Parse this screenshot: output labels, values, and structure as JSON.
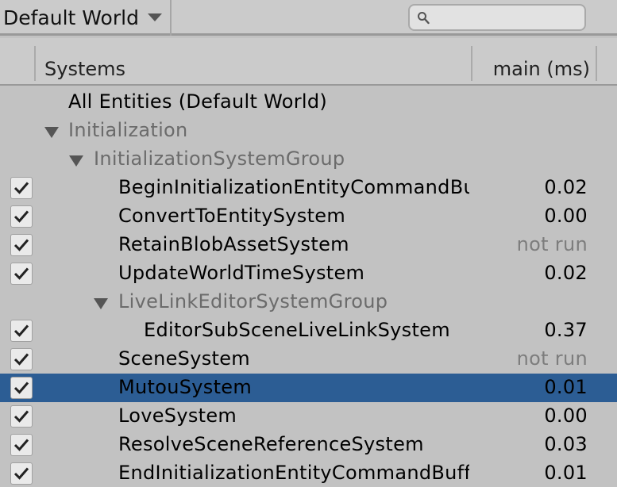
{
  "toolbar": {
    "world_label": "Default World",
    "search": {
      "value": "",
      "placeholder": ""
    }
  },
  "header": {
    "col_systems": "Systems",
    "col_main": "main (ms)"
  },
  "rows": [
    {
      "label": "All Entities (Default World)",
      "value": "",
      "checkbox": false,
      "group": false,
      "expanded": null,
      "selected": false
    },
    {
      "label": "Initialization",
      "value": "",
      "checkbox": false,
      "group": true,
      "expanded": true,
      "selected": false
    },
    {
      "label": "InitializationSystemGroup",
      "value": "",
      "checkbox": false,
      "group": true,
      "expanded": true,
      "selected": false
    },
    {
      "label": "BeginInitializationEntityCommandBufferSystem",
      "value": "0.02",
      "checkbox": true,
      "checked": true,
      "group": false,
      "selected": false
    },
    {
      "label": "ConvertToEntitySystem",
      "value": "0.00",
      "checkbox": true,
      "checked": true,
      "group": false,
      "selected": false
    },
    {
      "label": "RetainBlobAssetSystem",
      "value": "not run",
      "checkbox": true,
      "checked": true,
      "group": false,
      "selected": false
    },
    {
      "label": "UpdateWorldTimeSystem",
      "value": "0.02",
      "checkbox": true,
      "checked": true,
      "group": false,
      "selected": false
    },
    {
      "label": "LiveLinkEditorSystemGroup",
      "value": "",
      "checkbox": false,
      "group": true,
      "expanded": true,
      "selected": false
    },
    {
      "label": "EditorSubSceneLiveLinkSystem",
      "value": "0.37",
      "checkbox": true,
      "checked": true,
      "group": false,
      "selected": false
    },
    {
      "label": "SceneSystem",
      "value": "not run",
      "checkbox": true,
      "checked": true,
      "group": false,
      "selected": false
    },
    {
      "label": "MutouSystem",
      "value": "0.01",
      "checkbox": true,
      "checked": true,
      "group": false,
      "selected": true
    },
    {
      "label": "LoveSystem",
      "value": "0.00",
      "checkbox": true,
      "checked": true,
      "group": false,
      "selected": false
    },
    {
      "label": "ResolveSceneReferenceSystem",
      "value": "0.03",
      "checkbox": true,
      "checked": true,
      "group": false,
      "selected": false
    },
    {
      "label": "EndInitializationEntityCommandBufferSystem",
      "value": "0.01",
      "checkbox": true,
      "checked": true,
      "group": false,
      "selected": false
    }
  ],
  "colors": {
    "background": "#c2c2c2",
    "selected_row": "#2c5d94",
    "group_text": "#6b6b6b",
    "not_run_text": "#7d7d7d"
  },
  "icons": {
    "world_dropdown": "chevron-down-icon",
    "search": "search-icon",
    "expand": "triangle-down-icon",
    "check": "checkmark-icon"
  }
}
